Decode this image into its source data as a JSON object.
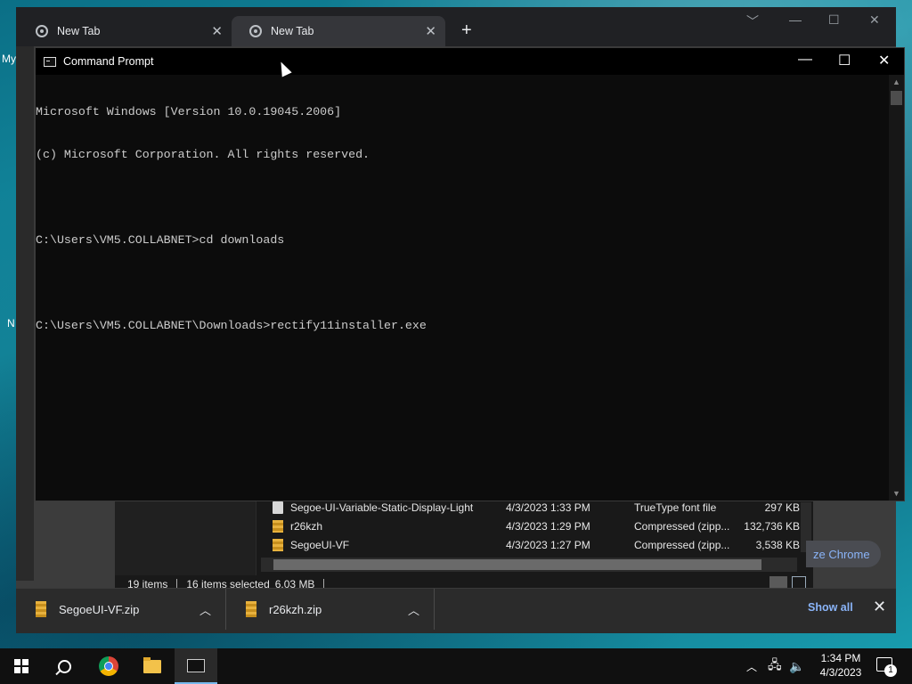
{
  "desktop": {
    "text_top": "My",
    "text_bottom": "N"
  },
  "chrome": {
    "tabs": [
      {
        "label": "New Tab"
      },
      {
        "label": "New Tab"
      }
    ],
    "new_tab_symbol": "+",
    "customize_label": "ze Chrome"
  },
  "explorer": {
    "files": [
      {
        "name": "Segoe-UI-Variable-Static-Display-Light",
        "date": "4/3/2023 1:33 PM",
        "type": "TrueType font file",
        "size": "297 KB",
        "icon": "font-file-icon"
      },
      {
        "name": "r26kzh",
        "date": "4/3/2023 1:29 PM",
        "type": "Compressed (zipp...",
        "size": "132,736 KB",
        "icon": "zip-folder-icon"
      },
      {
        "name": "SegoeUI-VF",
        "date": "4/3/2023 1:27 PM",
        "type": "Compressed (zipp...",
        "size": "3,538 KB",
        "icon": "zip-folder-icon"
      }
    ],
    "status": {
      "items": "19 items",
      "selected": "16 items selected",
      "size": "6.03 MB"
    }
  },
  "cmd": {
    "title": "Command Prompt",
    "lines": [
      "Microsoft Windows [Version 10.0.19045.2006]",
      "(c) Microsoft Corporation. All rights reserved.",
      "",
      "C:\\Users\\VM5.COLLABNET>cd downloads",
      "",
      "C:\\Users\\VM5.COLLABNET\\Downloads>rectify11installer.exe"
    ]
  },
  "downloads": {
    "items": [
      {
        "name": "SegoeUI-VF.zip"
      },
      {
        "name": "r26kzh.zip"
      }
    ],
    "show_all": "Show all"
  },
  "taskbar": {
    "time": "1:34 PM",
    "date": "4/3/2023",
    "notification_count": "1"
  },
  "colors": {
    "cmd_bg": "#0c0c0c",
    "cmd_text": "#cccccc",
    "link": "#8ab4f8",
    "taskbar_accent": "#76b9ed"
  }
}
